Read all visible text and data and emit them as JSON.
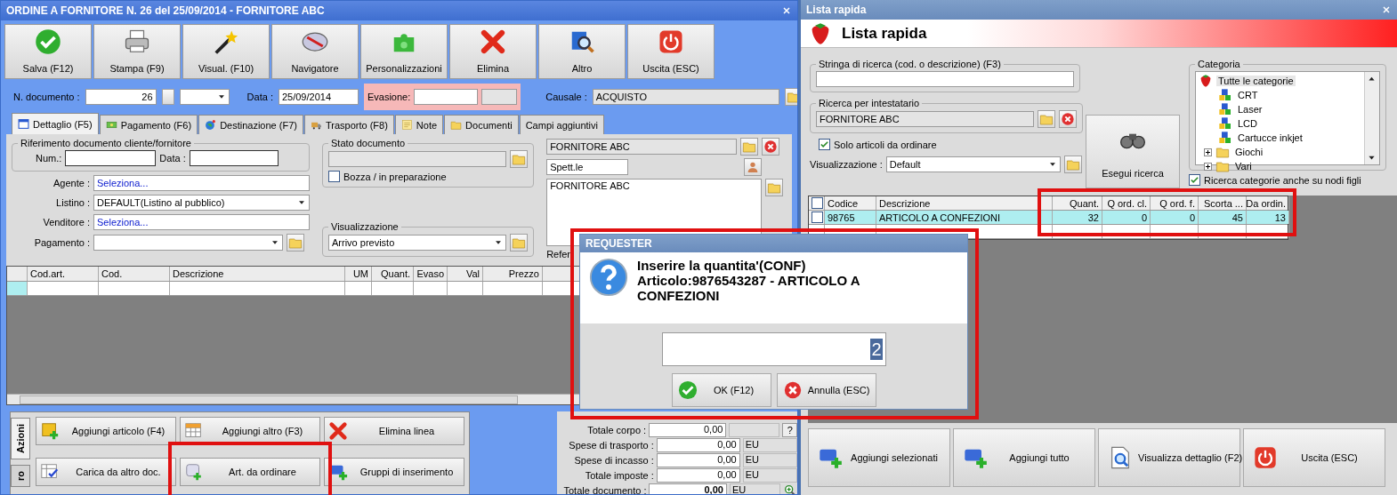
{
  "order_window": {
    "title": "ORDINE A FORNITORE N. 26 del 25/09/2014 - FORNITORE ABC",
    "toolbar": [
      {
        "label": "Salva (F12)"
      },
      {
        "label": "Stampa (F9)"
      },
      {
        "label": "Visual. (F10)"
      },
      {
        "label": "Navigatore"
      },
      {
        "label": "Personalizzazioni"
      },
      {
        "label": "Elimina"
      },
      {
        "label": "Altro"
      },
      {
        "label": "Uscita (ESC)"
      }
    ],
    "header": {
      "doc_number_label": "N. documento :",
      "doc_number": "26",
      "date_label": "Data :",
      "date": "25/09/2014",
      "evasione_label": "Evasione:",
      "causale_label": "Causale :",
      "causale": "ACQUISTO"
    },
    "tabs": [
      {
        "label": "Dettaglio (F5)",
        "selected": true
      },
      {
        "label": "Pagamento (F6)",
        "selected": false
      },
      {
        "label": "Destinazione (F7)",
        "selected": false
      },
      {
        "label": "Trasporto (F8)",
        "selected": false
      },
      {
        "label": "Note",
        "selected": false
      },
      {
        "label": "Documenti",
        "selected": false
      },
      {
        "label": "Campi aggiuntivi",
        "selected": false
      }
    ],
    "riferimento": {
      "title": "Riferimento documento cliente/fornitore",
      "num_label": "Num.:",
      "data_label": "Data :"
    },
    "fields": [
      {
        "label": "Agente :",
        "value": "Seleziona...",
        "kind": "link"
      },
      {
        "label": "Listino :",
        "value": "DEFAULT(Listino al pubblico)",
        "kind": "select"
      },
      {
        "label": "Venditore :",
        "value": "Seleziona...",
        "kind": "link"
      },
      {
        "label": "Pagamento :",
        "kind": "select_folder"
      }
    ],
    "stato": {
      "title": "Stato documento",
      "bozza_label": "Bozza / in preparazione",
      "bozza_checked": false
    },
    "visualizzazione": {
      "title": "Visualizzazione",
      "value": "Arrivo previsto"
    },
    "intestatario": {
      "name": "FORNITORE ABC",
      "salutation": "Spett.le",
      "address": "FORNITORE ABC",
      "reference_label": "Refer"
    },
    "grid": {
      "columns": [
        "Cod.art.",
        "Cod.",
        "Descrizione",
        "UM",
        "Quant.",
        "Evaso",
        "Val",
        "Prezzo"
      ]
    },
    "actions": {
      "tab_label": "Azioni",
      "second_tab_label": "ro",
      "buttons": [
        {
          "label": "Aggiungi articolo (F4)"
        },
        {
          "label": "Aggiungi altro (F3)"
        },
        {
          "label": "Elimina linea"
        },
        {
          "label": "Carica da altro doc."
        },
        {
          "label": "Art. da ordinare"
        },
        {
          "label": "Gruppi di inserimento"
        }
      ]
    },
    "totals": [
      {
        "label": "Totale corpo :",
        "value": "0,00",
        "emphasis": false
      },
      {
        "label": "Spese di trasporto :",
        "value": "0,00",
        "unit": "EU",
        "emphasis": false
      },
      {
        "label": "Spese di incasso :",
        "value": "0,00",
        "unit": "EU",
        "emphasis": false
      },
      {
        "label": "Totale imposte :",
        "value": "0,00",
        "unit": "EU",
        "emphasis": false
      },
      {
        "label": "Totale documento :",
        "value": "0,00",
        "unit": "EU",
        "emphasis": true
      }
    ],
    "help_button": "?"
  },
  "lista_window": {
    "title": "Lista rapida",
    "heading": "Lista rapida",
    "search_title": "Stringa di ricerca (cod. o descrizione) (F3)",
    "intestatario_title": "Ricerca per intestatario",
    "intestatario_value": "FORNITORE ABC",
    "solo": {
      "label": "Solo articoli da ordinare",
      "checked": true
    },
    "view_label": "Visualizzazione :",
    "view_value": "Default",
    "search_button": "Esegui ricerca",
    "category": {
      "title": "Categoria",
      "tree": [
        {
          "label": "Tutte le categorie",
          "selected": true,
          "children": [
            {
              "label": "CRT",
              "selected": false
            },
            {
              "label": "Laser",
              "selected": false
            },
            {
              "label": "LCD",
              "selected": false
            },
            {
              "label": "Cartucce inkjet",
              "selected": false
            },
            {
              "label": "Giochi",
              "selected": false,
              "expanded": false
            },
            {
              "label": "Vari",
              "selected": false,
              "expanded": false
            }
          ]
        }
      ]
    },
    "subnodes": {
      "label": "Ricerca categorie anche su nodi figli",
      "checked": true
    },
    "table": {
      "select_all_checked": false,
      "columns": [
        "Codice",
        "Descrizione",
        "Quant.",
        "Q ord. cl.",
        "Q ord. f.",
        "Scorta ...",
        "Da ordin."
      ],
      "rows": [
        {
          "checked": false,
          "selected": true,
          "cells": [
            "98765",
            "ARTICOLO A CONFEZIONI",
            "32",
            "0",
            "0",
            "45",
            "13"
          ]
        }
      ]
    },
    "buttons": [
      {
        "label": "Aggiungi selezionati"
      },
      {
        "label": "Aggiungi tutto"
      },
      {
        "label": "Visualizza dettaglio (F2)"
      },
      {
        "label": "Uscita (ESC)"
      }
    ]
  },
  "requester": {
    "title": "REQUESTER",
    "message": [
      "Inserire la quantita'(CONF)",
      "Articolo:9876543287 - ARTICOLO A CONFEZIONI"
    ],
    "value": "2",
    "buttons": [
      {
        "label": "OK (F12)"
      },
      {
        "label": "Annulla (ESC)"
      }
    ]
  }
}
